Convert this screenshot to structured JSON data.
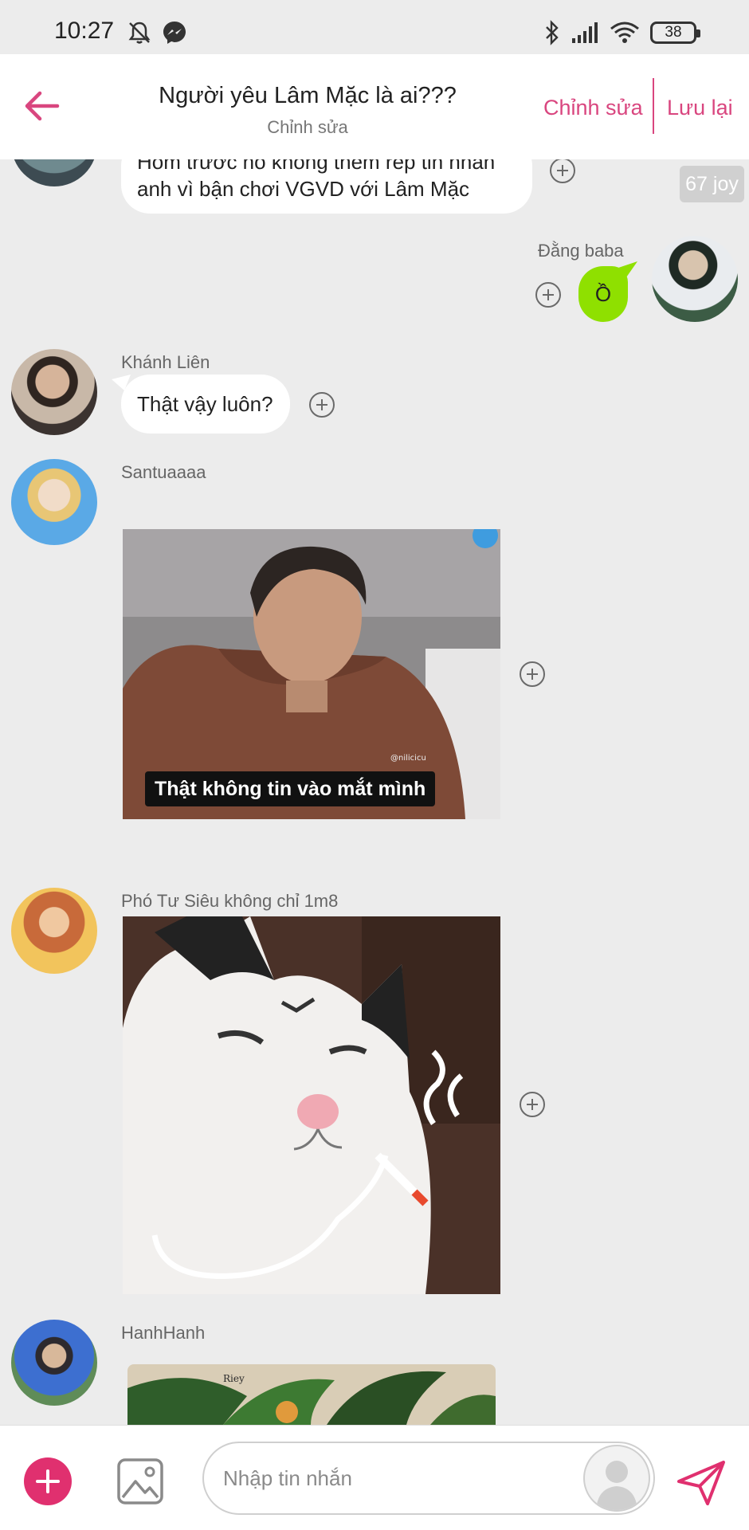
{
  "status_bar": {
    "time": "10:27",
    "battery": "38",
    "icons": [
      "mute-icon",
      "messenger-icon",
      "bluetooth-icon",
      "signal-icon",
      "wifi-icon",
      "battery-icon"
    ]
  },
  "header": {
    "title": "Người yêu Lâm Mặc là ai???",
    "subtitle": "Chỉnh sửa",
    "edit_label": "Chỉnh sửa",
    "save_label": "Lưu lại",
    "accent_color": "#d9467f"
  },
  "messages": [
    {
      "type": "text",
      "lines": [
        "Hôm trước nó không thèm rep tin nhắn",
        "anh vì bận chơi VGVD với Lâm Mặc"
      ],
      "badge": "67 joy"
    },
    {
      "type": "text",
      "sender": "Đằng baba",
      "text": "Ồ",
      "outgoing": true,
      "bubble_color": "#8fe000"
    },
    {
      "type": "text",
      "sender": "Khánh Liên",
      "text": "Thật vậy luôn?"
    },
    {
      "type": "image",
      "sender": "Santuaaaa",
      "caption": "Thật không tin vào mắt mình",
      "watermark": "@nilicicu"
    },
    {
      "type": "image",
      "sender": "Phó Tư Siêu không chỉ 1m8"
    },
    {
      "type": "image",
      "sender": "HanhHanh",
      "watermark": "Riey"
    }
  ],
  "composer": {
    "placeholder": "Nhập tin nhắn",
    "accent_color": "#e0306f"
  }
}
